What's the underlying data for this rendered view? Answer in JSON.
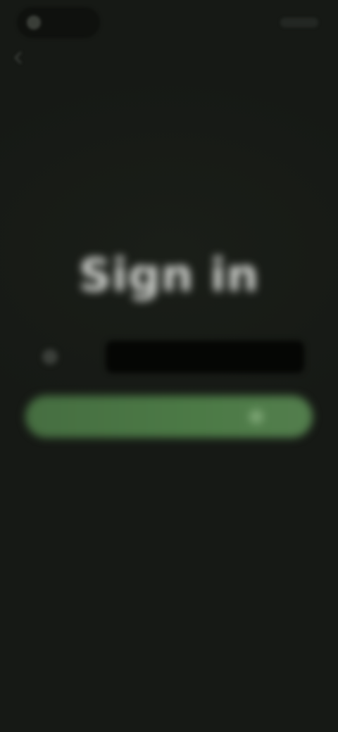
{
  "status_bar": {
    "left_text": "",
    "right_text": ""
  },
  "main": {
    "title": "Sign in",
    "input": {
      "label": "",
      "value": "",
      "placeholder": ""
    },
    "primary_button_label": "",
    "secondary_link_label": ""
  },
  "colors": {
    "background": "#161915",
    "accent": "#4c7a46",
    "title": "#e9ebe7",
    "input_bg": "#050604"
  },
  "icons": {
    "back": "back-arrow-icon",
    "status": "status-dot-icon",
    "input": "input-leading-icon",
    "button_end": "button-trailing-icon"
  }
}
